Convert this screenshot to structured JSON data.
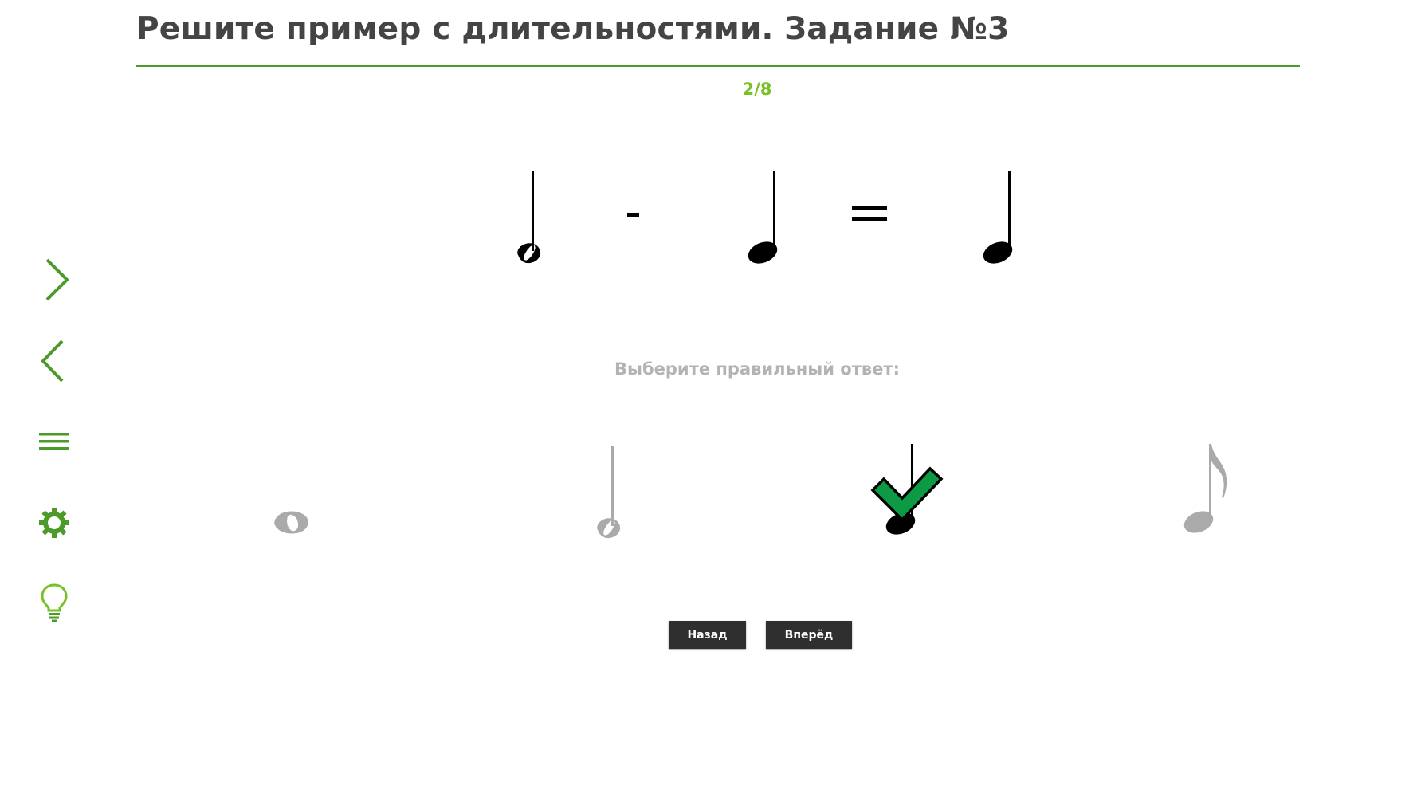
{
  "header": {
    "title": "Решите пример с длительностями. Задание №3",
    "progress": "2/8"
  },
  "sidebar": {
    "items": [
      {
        "icon": "chevron-right-icon"
      },
      {
        "icon": "chevron-left-icon"
      },
      {
        "icon": "menu-icon"
      },
      {
        "icon": "gear-icon"
      },
      {
        "icon": "lightbulb-icon"
      }
    ]
  },
  "equation": {
    "terms": [
      {
        "kind": "note",
        "value": "half-note"
      },
      {
        "kind": "operator",
        "value": "-"
      },
      {
        "kind": "note",
        "value": "quarter-note"
      },
      {
        "kind": "operator",
        "value": "="
      },
      {
        "kind": "note",
        "value": "quarter-note"
      }
    ]
  },
  "question": {
    "prompt": "Выберите правильный ответ:",
    "options": [
      {
        "note": "whole-note",
        "selected": false
      },
      {
        "note": "half-note",
        "selected": false
      },
      {
        "note": "quarter-note",
        "selected": true,
        "marked_correct": true
      },
      {
        "note": "eighth-note",
        "selected": false
      }
    ]
  },
  "navigation": {
    "back_label": "Назад",
    "forward_label": "Вперёд"
  },
  "colors": {
    "accent_green": "#77c128",
    "sidebar_green": "#4c9a2a",
    "check_green": "#0d9a45",
    "option_gray": "#aaaaaa",
    "title_color": "#444444",
    "button_bg": "#2f2f2f"
  }
}
